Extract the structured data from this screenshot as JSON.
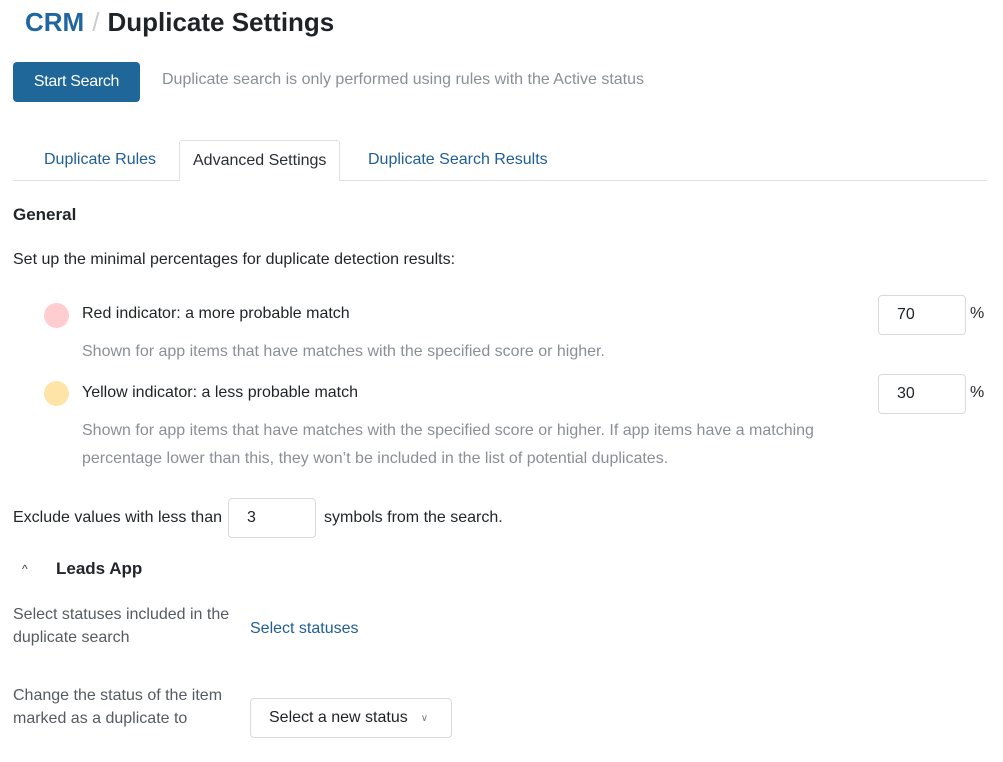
{
  "header": {
    "breadcrumb_root": "CRM",
    "separator": "/",
    "title": "Duplicate Settings"
  },
  "toolbar": {
    "start_search_label": "Start Search",
    "hint": "Duplicate search is only performed using rules with the Active status"
  },
  "tabs": [
    {
      "label": "Duplicate Rules",
      "active": false
    },
    {
      "label": "Advanced Settings",
      "active": true
    },
    {
      "label": "Duplicate Search Results",
      "active": false
    }
  ],
  "general": {
    "heading": "General",
    "setup_text": "Set up the minimal percentages for duplicate detection results:",
    "red": {
      "label": "Red indicator: a more probable match",
      "description": "Shown for app items that have matches with the specified score or higher.",
      "value": "70",
      "unit": "%",
      "color": "#ffcdd0"
    },
    "yellow": {
      "label": "Yellow indicator: a less probable match",
      "description": "Shown for app items that have matches with the specified score or higher. If app items have a matching percentage lower than this, they won’t be included in the list of potential duplicates.",
      "value": "30",
      "unit": "%",
      "color": "#ffe4a8"
    },
    "exclude": {
      "prefix": "Exclude values with less than",
      "value": "3",
      "suffix": "symbols from the search."
    }
  },
  "leads_app": {
    "title": "Leads App",
    "expanded_icon": "chevron-up-icon",
    "statuses_label": "Select statuses included in the duplicate search",
    "statuses_link": "Select statuses",
    "change_status_label": "Change the status of the item marked as a duplicate to",
    "change_status_placeholder": "Select a new status",
    "dropdown_icon": "chevron-down-icon"
  }
}
